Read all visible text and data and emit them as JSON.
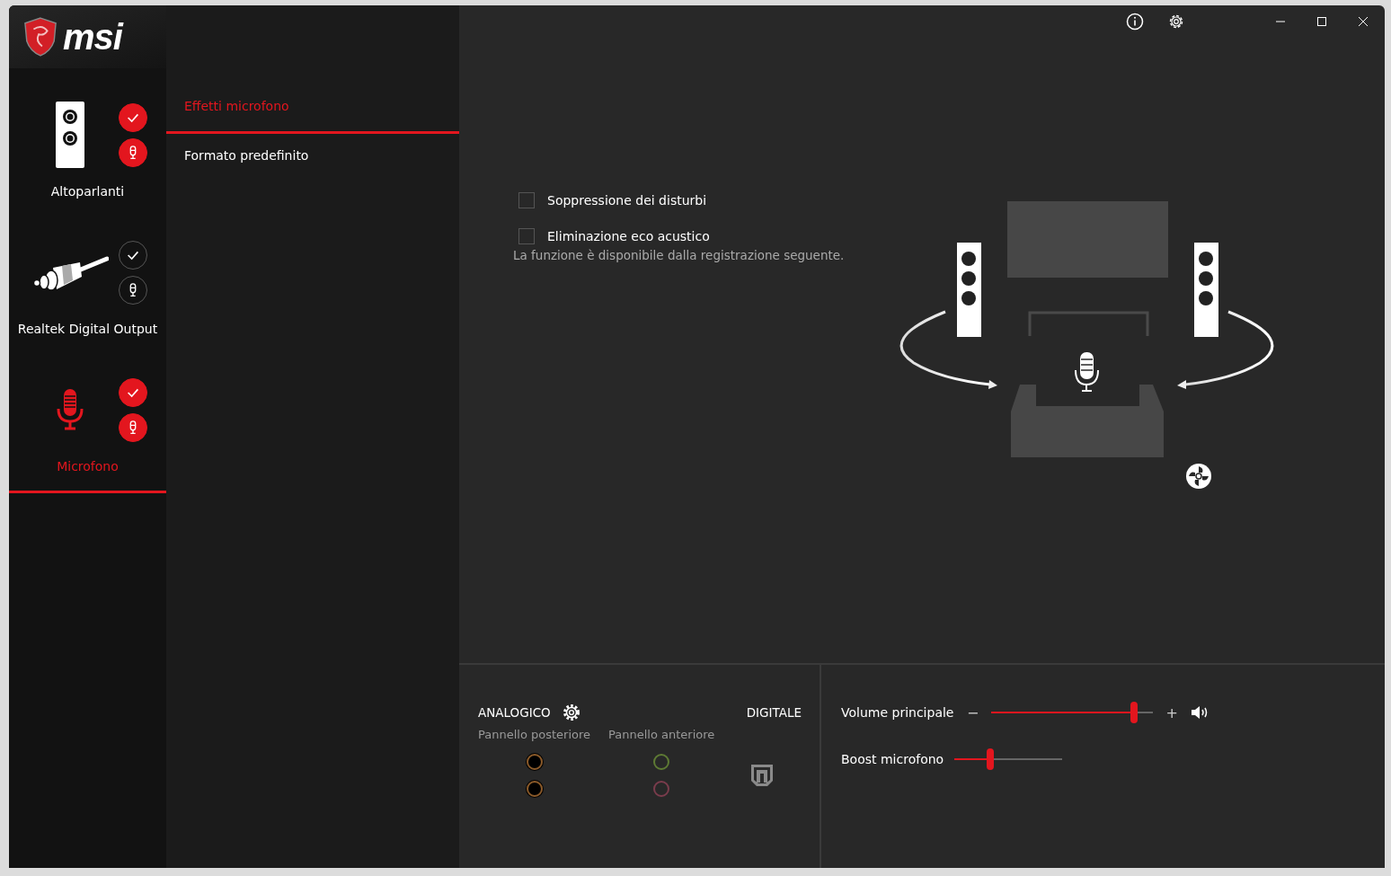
{
  "brand": {
    "logo_text": "msi"
  },
  "devices": [
    {
      "name": "Altoparlanti",
      "kind": "speaker",
      "selected": false,
      "default": true,
      "default_communication": true
    },
    {
      "name": "Realtek Digital Output",
      "kind": "cable",
      "selected": false,
      "default": false,
      "default_communication": false
    },
    {
      "name": "Microfono",
      "kind": "mic",
      "selected": true,
      "default": true,
      "default_communication": true
    }
  ],
  "tabs": [
    {
      "label": "Effetti microfono",
      "selected": true
    },
    {
      "label": "Formato predefinito",
      "selected": false
    }
  ],
  "options": [
    {
      "label": "Soppressione dei disturbi",
      "checked": false
    },
    {
      "label": "Eliminazione eco acustico",
      "checked": false
    }
  ],
  "note": "La funzione è disponibile dalla registrazione seguente.",
  "connectors": {
    "analog_label": "ANALOGICO",
    "digital_label": "DIGITALE",
    "panels": [
      {
        "label": "Pannello posteriore",
        "jacks": [
          {
            "color": "#8a5a2a"
          },
          {
            "color": "#8a5a2a"
          }
        ]
      },
      {
        "label": "Pannello anteriore",
        "jacks": [
          {
            "color": "#5e7a34"
          },
          {
            "color": "#7a3c4c"
          }
        ]
      }
    ]
  },
  "levels": [
    {
      "label": "Volume principale",
      "kind": "volume",
      "level": 0.88,
      "minus": "−",
      "plus": "+"
    },
    {
      "label": "Boost microfono",
      "kind": "boost",
      "level": 0.33
    }
  ]
}
